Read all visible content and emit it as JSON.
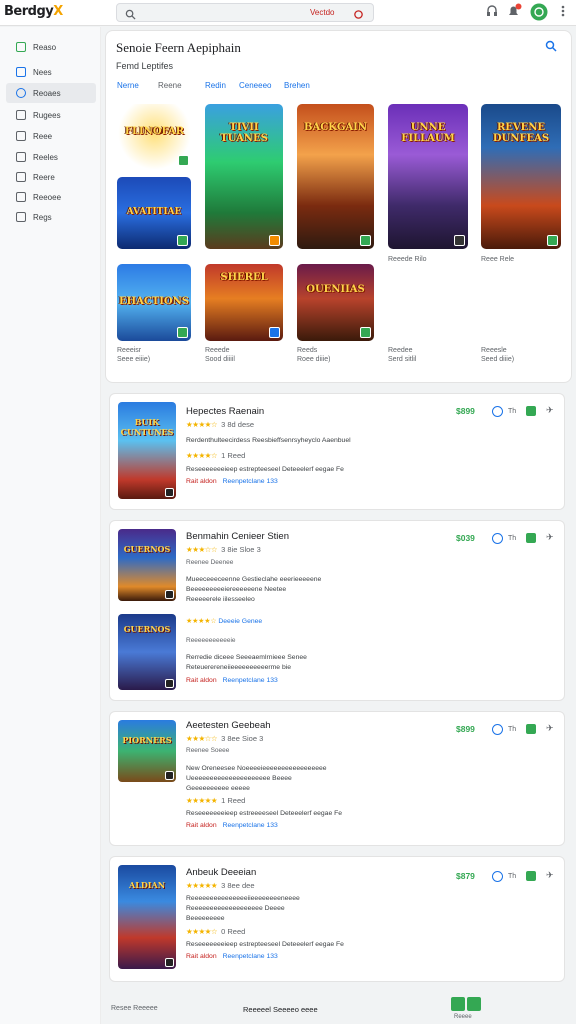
{
  "app": {
    "logo_part1": "Berdgy",
    "logo_part2": "X"
  },
  "search": {
    "label": "Vectdo"
  },
  "sidebar": {
    "items": [
      {
        "label": "Reaso"
      },
      {
        "label": "Nees"
      },
      {
        "label": "Reoaes"
      },
      {
        "label": "Rugees"
      },
      {
        "label": "Reee"
      },
      {
        "label": "Reeles"
      },
      {
        "label": "Reere"
      },
      {
        "label": "Reeoee"
      },
      {
        "label": "Regs"
      }
    ]
  },
  "featured": {
    "title": "Senoie Feern Aepiphain",
    "subtitle": "Femd Leptifes",
    "tabs": [
      "Nerne",
      "Reene",
      "Redin",
      "Ceneeeo",
      "Brehen"
    ],
    "captions": [
      {
        "l1": "Reeede Rilo",
        "l2": ""
      },
      {
        "l1": "Reee Rele",
        "l2": ""
      },
      {
        "l1": "Reeeisr",
        "l2": "Seee eiiie)"
      },
      {
        "l1": "Reeede",
        "l2": "Sood diiiil"
      },
      {
        "l1": "Reeds",
        "l2": "Roee diiie)"
      },
      {
        "l1": "Reedee",
        "l2": "Serd sitlil"
      },
      {
        "l1": "Reeesle",
        "l2": "Seed diiie)"
      }
    ],
    "art": [
      "FLINOFAR",
      "TIVII TUANES",
      "BACKGAIN",
      "UNNE FILLAUM",
      "REVENE DUNFEAS",
      "AVATITIAE",
      "EHACTIONS",
      "SHEREL",
      "OUENIIAS"
    ]
  },
  "cards": [
    {
      "title": "Hepectes Raenain",
      "stars": "★★★★☆",
      "rating": "3 8d dese",
      "desc1": "Rerdenthulteecirdess Reesbieffsenrsyheyclo Aaenbuel",
      "stars2": "★★★★☆",
      "rating2": "1 Reed",
      "desc2": "Reseeeeeeeieep estrepteeseel Deteeelerf eegae Fe",
      "meta_red": "Rait aldon",
      "meta_blue": "Reenpetclane 133",
      "price": "$899",
      "code": "Th",
      "thumb_art": "BUIK CUNTUNES"
    },
    {
      "title": "Benmahin Cenieer Stien",
      "stars": "★★★☆☆",
      "rating": "3 8ie Sloe 3",
      "rating_sub": "Reenee Deenee",
      "desc1": "Mueeceeeceenne Gestieclahe eeerieeeeene",
      "desc1b": "Beeeeeeeeeiereeeeeene Neetee",
      "desc1c": "Reeeeerele iilesseeleo",
      "promo": "Deeeie Genee",
      "small_label": "Reeeeeeeeeeeie",
      "desc2": "Rerredie diceee Seeeaemlrnieee Senee",
      "desc2b": "Reteuerereneiieeeeeeeeeerme bie",
      "meta_red": "Rait aldon",
      "meta_blue": "Reenpetclane 133",
      "price": "$039",
      "code": "Th",
      "thumb_art": "GUERNOS"
    },
    {
      "title": "Aeetesten Geebeah",
      "stars": "★★★☆☆",
      "rating": "3 8ee Sioe 3",
      "rating_sub": "Reenee Soeee",
      "desc1": "New Oreneesee Noeeeeieeeeeeeeeeeeeeeee",
      "desc1b": "Ueeeeeeeeeeeeeeeeeeeee Beeee",
      "desc1c": "Geeeeeeeeee eeeee",
      "stars2": "★★★★★",
      "rating2": "1 Reed",
      "desc2": "Reseeeeeeeieep estreeeeseel Deteeelerf eegae Fe",
      "meta_red": "Rait aldon",
      "meta_blue": "Reenpetclane 133",
      "price": "$899",
      "code": "Th",
      "thumb_art": "PIORNERS"
    },
    {
      "title": "Anbeuk Deeeian",
      "stars": "★★★★★",
      "rating": "3 8ee dee",
      "desc1": "Reeeeeeeeeeeeeeeiieeeeeeeeneeee",
      "desc1b": "Reeeeeeeeeeeeeeeeeee Deeee",
      "desc1c": "Beeeeeeeee",
      "stars2": "★★★★☆",
      "rating2": "0 Reed",
      "desc2": "Reseeeeeeeieep estrepteeseel Deteeelerf eegae Fe",
      "meta_red": "Rait aldon",
      "meta_blue": "Reenpetclane 133",
      "price": "$879",
      "code": "Th",
      "thumb_art": "ALDIAN"
    }
  ],
  "footer": {
    "left": "Resee Reeeee",
    "mid": "Reeeeel Seeeeo eeee",
    "btn_label": "Reeee"
  }
}
